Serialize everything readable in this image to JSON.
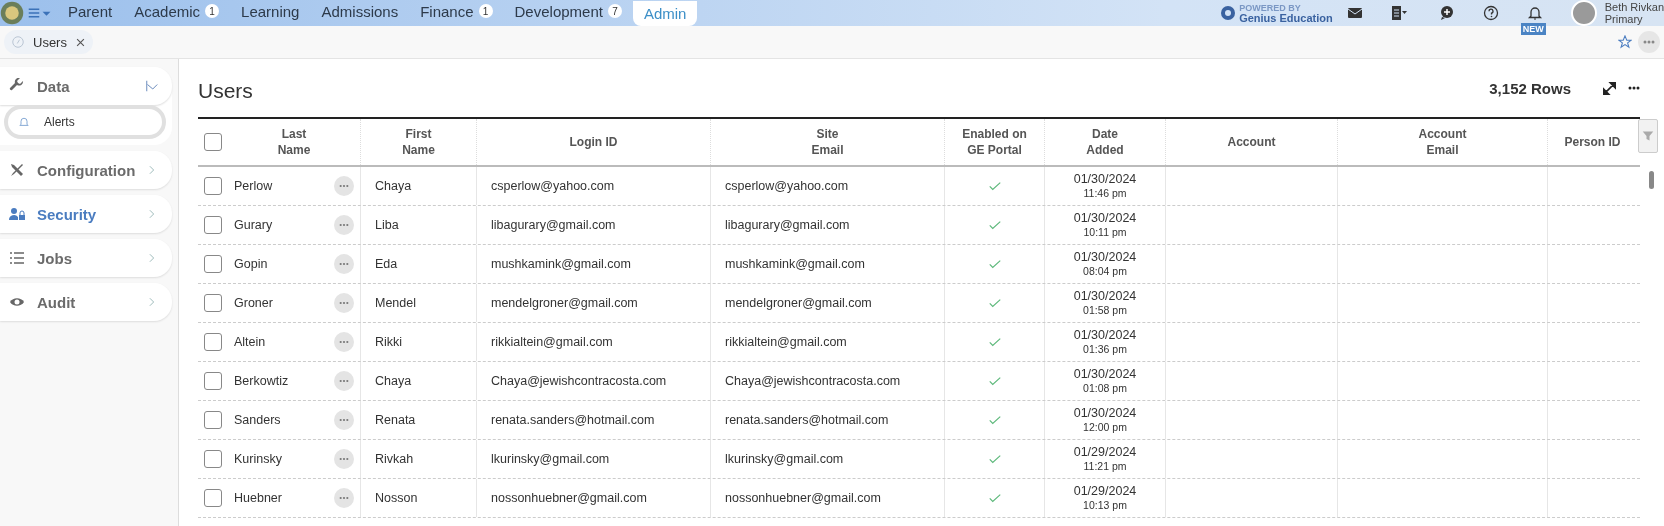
{
  "topbar": {
    "nav": [
      {
        "label": "Parent",
        "selected": false
      },
      {
        "label": "Academic",
        "count": "1",
        "selected": false
      },
      {
        "label": "Learning",
        "selected": false
      },
      {
        "label": "Admissions",
        "selected": false
      },
      {
        "label": "Finance",
        "count": "1",
        "selected": false
      },
      {
        "label": "Development",
        "count": "7",
        "selected": false
      },
      {
        "label": "Admin",
        "selected": true
      }
    ],
    "powered_by": "POWERED BY",
    "brand": "Genius Education",
    "notification_badge": "NEW",
    "user_name": "Beth Rivkan",
    "user_role": "Primary"
  },
  "open_tabs": [
    {
      "label": "Users"
    }
  ],
  "sidebar": {
    "items": [
      {
        "label": "Data",
        "expanded": true,
        "selected": false,
        "children": [
          {
            "label": "Alerts",
            "selected": true
          }
        ]
      },
      {
        "label": "Configuration",
        "expanded": false,
        "selected": false
      },
      {
        "label": "Security",
        "expanded": false,
        "selected": true
      },
      {
        "label": "Jobs",
        "expanded": false,
        "selected": false
      },
      {
        "label": "Audit",
        "expanded": false,
        "selected": false
      }
    ]
  },
  "page": {
    "title": "Users",
    "row_count": "3,152 Rows"
  },
  "table": {
    "select_all_checked": false,
    "columns": [
      "Last\nName",
      "First\nName",
      "Login ID",
      "Site\nEmail",
      "Enabled on\nGE Portal",
      "Date\nAdded",
      "Account",
      "Account\nEmail",
      "Person ID"
    ],
    "rows": [
      {
        "checked": false,
        "last": "Perlow",
        "first": "Chaya",
        "login": "csperlow@yahoo.com",
        "email": "csperlow@yahoo.com",
        "enabled": true,
        "date": "01/30/2024",
        "time": "11:46 pm"
      },
      {
        "checked": false,
        "last": "Gurary",
        "first": "Liba",
        "login": "libagurary@gmail.com",
        "email": "libagurary@gmail.com",
        "enabled": true,
        "date": "01/30/2024",
        "time": "10:11 pm"
      },
      {
        "checked": false,
        "last": "Gopin",
        "first": "Eda",
        "login": "mushkamink@gmail.com",
        "email": "mushkamink@gmail.com",
        "enabled": true,
        "date": "01/30/2024",
        "time": "08:04 pm"
      },
      {
        "checked": false,
        "last": "Groner",
        "first": "Mendel",
        "login": "mendelgroner@gmail.com",
        "email": "mendelgroner@gmail.com",
        "enabled": true,
        "date": "01/30/2024",
        "time": "01:58 pm"
      },
      {
        "checked": false,
        "last": "Altein",
        "first": "Rikki",
        "login": "rikkialtein@gmail.com",
        "email": "rikkialtein@gmail.com",
        "enabled": true,
        "date": "01/30/2024",
        "time": "01:36 pm"
      },
      {
        "checked": false,
        "last": "Berkowtiz",
        "first": "Chaya",
        "login": "Chaya@jewishcontracosta.com",
        "email": "Chaya@jewishcontracosta.com",
        "enabled": true,
        "date": "01/30/2024",
        "time": "01:08 pm"
      },
      {
        "checked": false,
        "last": "Sanders",
        "first": "Renata",
        "login": "renata.sanders@hotmail.com",
        "email": "renata.sanders@hotmail.com",
        "enabled": true,
        "date": "01/30/2024",
        "time": "12:00 pm"
      },
      {
        "checked": false,
        "last": "Kurinsky",
        "first": "Rivkah",
        "login": "lkurinsky@gmail.com",
        "email": "lkurinsky@gmail.com",
        "enabled": true,
        "date": "01/29/2024",
        "time": "11:21 pm"
      },
      {
        "checked": false,
        "last": "Huebner",
        "first": "Nosson",
        "login": "nossonhuebner@gmail.com",
        "email": "nossonhuebner@gmail.com",
        "enabled": true,
        "date": "01/29/2024",
        "time": "10:13 pm"
      }
    ]
  }
}
